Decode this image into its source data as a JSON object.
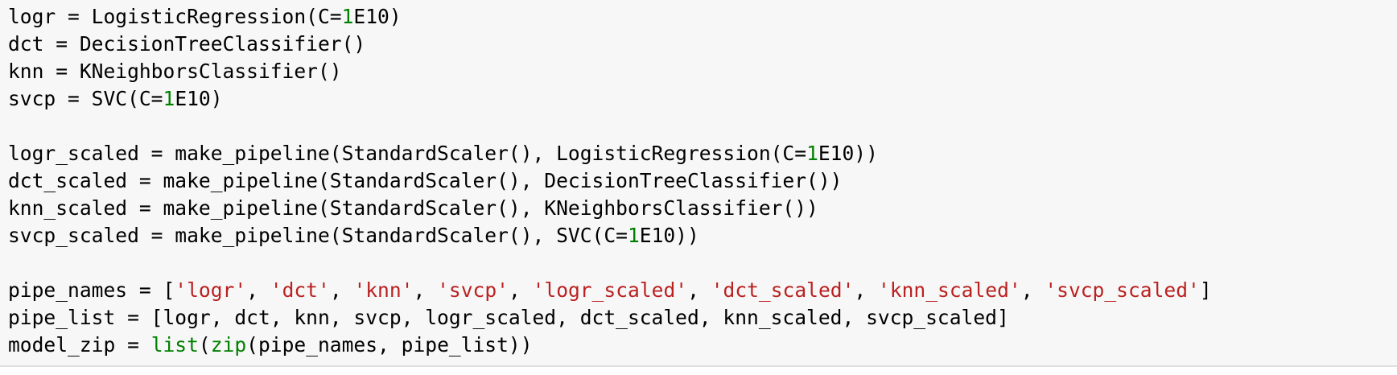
{
  "colors": {
    "background": "#f7f7f7",
    "text": "#000000",
    "number": "#008000",
    "string": "#ba2121",
    "builtin": "#008000",
    "border": "#dedede"
  },
  "code_lines": [
    [
      {
        "t": "plain",
        "v": "logr = LogisticRegression(C="
      },
      {
        "t": "num",
        "v": "1"
      },
      {
        "t": "plain",
        "v": "E10)"
      }
    ],
    [
      {
        "t": "plain",
        "v": "dct = DecisionTreeClassifier()"
      }
    ],
    [
      {
        "t": "plain",
        "v": "knn = KNeighborsClassifier()"
      }
    ],
    [
      {
        "t": "plain",
        "v": "svcp = SVC(C="
      },
      {
        "t": "num",
        "v": "1"
      },
      {
        "t": "plain",
        "v": "E10)"
      }
    ],
    [],
    [
      {
        "t": "plain",
        "v": "logr_scaled = make_pipeline(StandardScaler(), LogisticRegression(C="
      },
      {
        "t": "num",
        "v": "1"
      },
      {
        "t": "plain",
        "v": "E10))"
      }
    ],
    [
      {
        "t": "plain",
        "v": "dct_scaled = make_pipeline(StandardScaler(), DecisionTreeClassifier())"
      }
    ],
    [
      {
        "t": "plain",
        "v": "knn_scaled = make_pipeline(StandardScaler(), KNeighborsClassifier())"
      }
    ],
    [
      {
        "t": "plain",
        "v": "svcp_scaled = make_pipeline(StandardScaler(), SVC(C="
      },
      {
        "t": "num",
        "v": "1"
      },
      {
        "t": "plain",
        "v": "E10))"
      }
    ],
    [],
    [
      {
        "t": "plain",
        "v": "pipe_names = ["
      },
      {
        "t": "str",
        "v": "'logr'"
      },
      {
        "t": "plain",
        "v": ", "
      },
      {
        "t": "str",
        "v": "'dct'"
      },
      {
        "t": "plain",
        "v": ", "
      },
      {
        "t": "str",
        "v": "'knn'"
      },
      {
        "t": "plain",
        "v": ", "
      },
      {
        "t": "str",
        "v": "'svcp'"
      },
      {
        "t": "plain",
        "v": ", "
      },
      {
        "t": "str",
        "v": "'logr_scaled'"
      },
      {
        "t": "plain",
        "v": ", "
      },
      {
        "t": "str",
        "v": "'dct_scaled'"
      },
      {
        "t": "plain",
        "v": ", "
      },
      {
        "t": "str",
        "v": "'knn_scaled'"
      },
      {
        "t": "plain",
        "v": ", "
      },
      {
        "t": "str",
        "v": "'svcp_scaled'"
      },
      {
        "t": "plain",
        "v": "]"
      }
    ],
    [
      {
        "t": "plain",
        "v": "pipe_list = [logr, dct, knn, svcp, logr_scaled, dct_scaled, knn_scaled, svcp_scaled]"
      }
    ],
    [
      {
        "t": "plain",
        "v": "model_zip = "
      },
      {
        "t": "builtin",
        "v": "list"
      },
      {
        "t": "plain",
        "v": "("
      },
      {
        "t": "builtin",
        "v": "zip"
      },
      {
        "t": "plain",
        "v": "(pipe_names, pipe_list))"
      }
    ]
  ]
}
